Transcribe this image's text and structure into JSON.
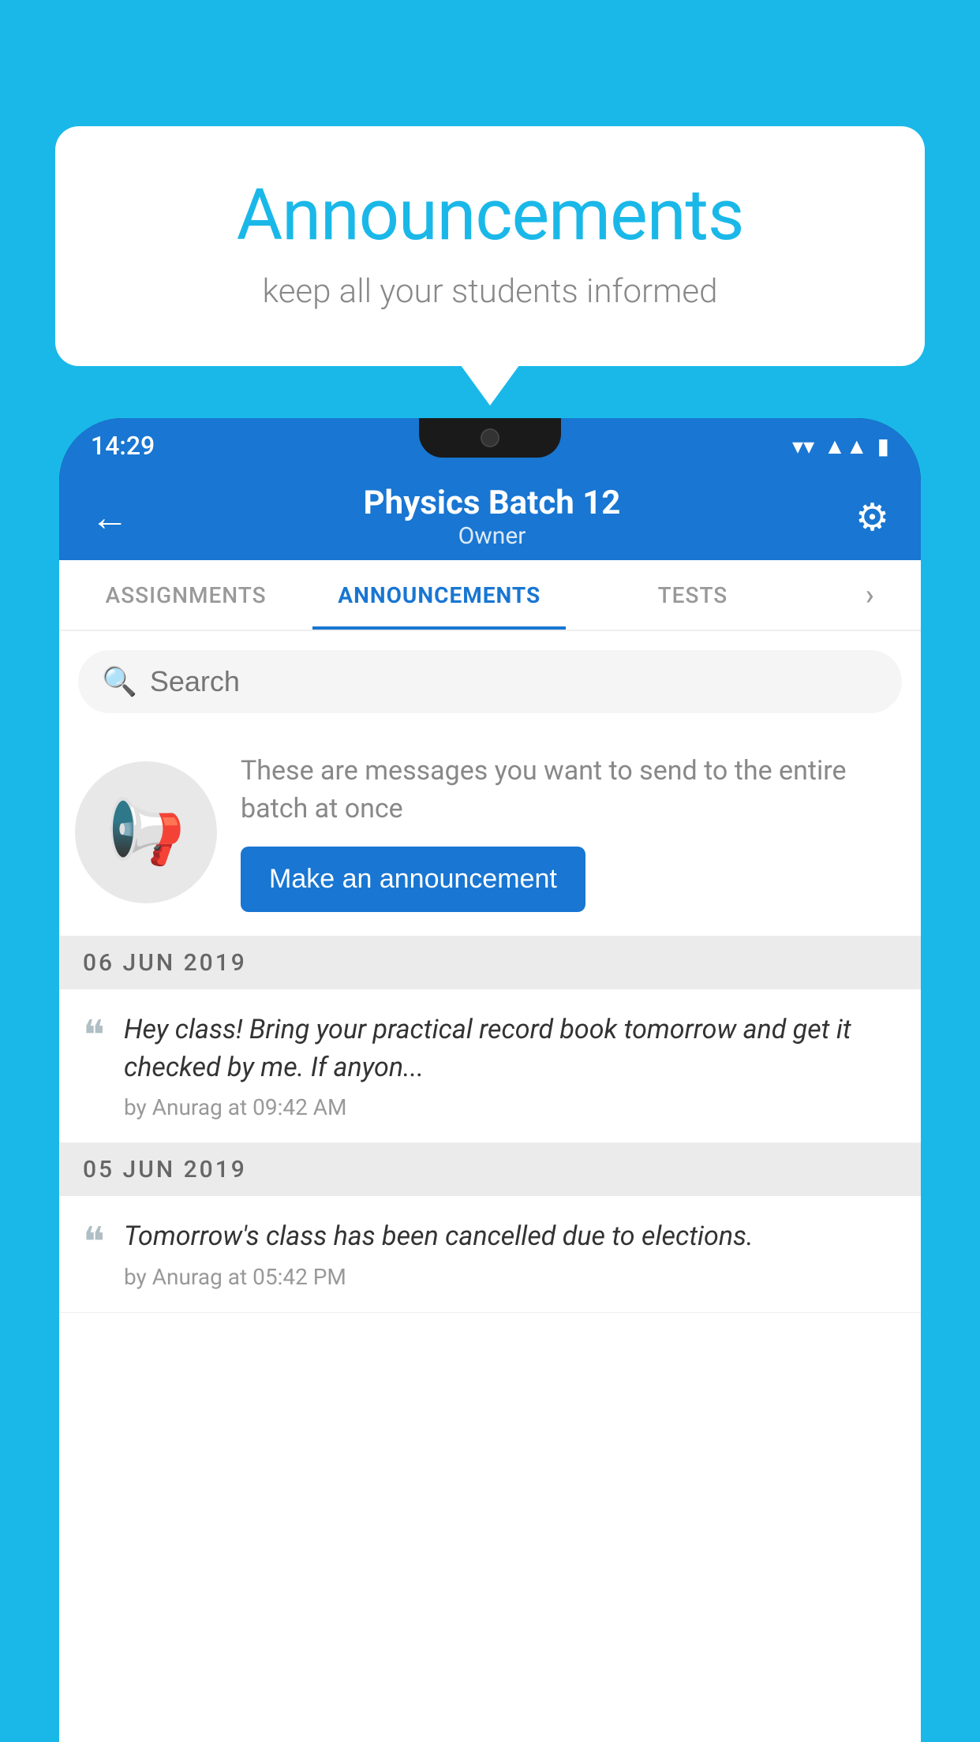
{
  "page": {
    "background_color": "#1ab8e8"
  },
  "speech_bubble": {
    "title": "Announcements",
    "subtitle": "keep all your students informed"
  },
  "status_bar": {
    "time": "14:29",
    "wifi_icon": "▼",
    "signal_icon": "▲",
    "battery_icon": "▮"
  },
  "app_bar": {
    "back_icon": "←",
    "batch_name": "Physics Batch 12",
    "batch_role": "Owner",
    "settings_icon": "⚙"
  },
  "tabs": [
    {
      "label": "ASSIGNMENTS",
      "active": false
    },
    {
      "label": "ANNOUNCEMENTS",
      "active": true
    },
    {
      "label": "TESTS",
      "active": false
    },
    {
      "label": "•••",
      "active": false
    }
  ],
  "search": {
    "placeholder": "Search",
    "icon": "🔍"
  },
  "empty_state": {
    "description_text": "These are messages you want to send to the entire batch at once",
    "button_label": "Make an announcement"
  },
  "announcements": [
    {
      "date_label": "06  JUN  2019",
      "text": "Hey class! Bring your practical record book tomorrow and get it checked by me. If anyon...",
      "meta": "by Anurag at 09:42 AM"
    },
    {
      "date_label": "05  JUN  2019",
      "text": "Tomorrow's class has been cancelled due to elections.",
      "meta": "by Anurag at 05:42 PM"
    }
  ]
}
